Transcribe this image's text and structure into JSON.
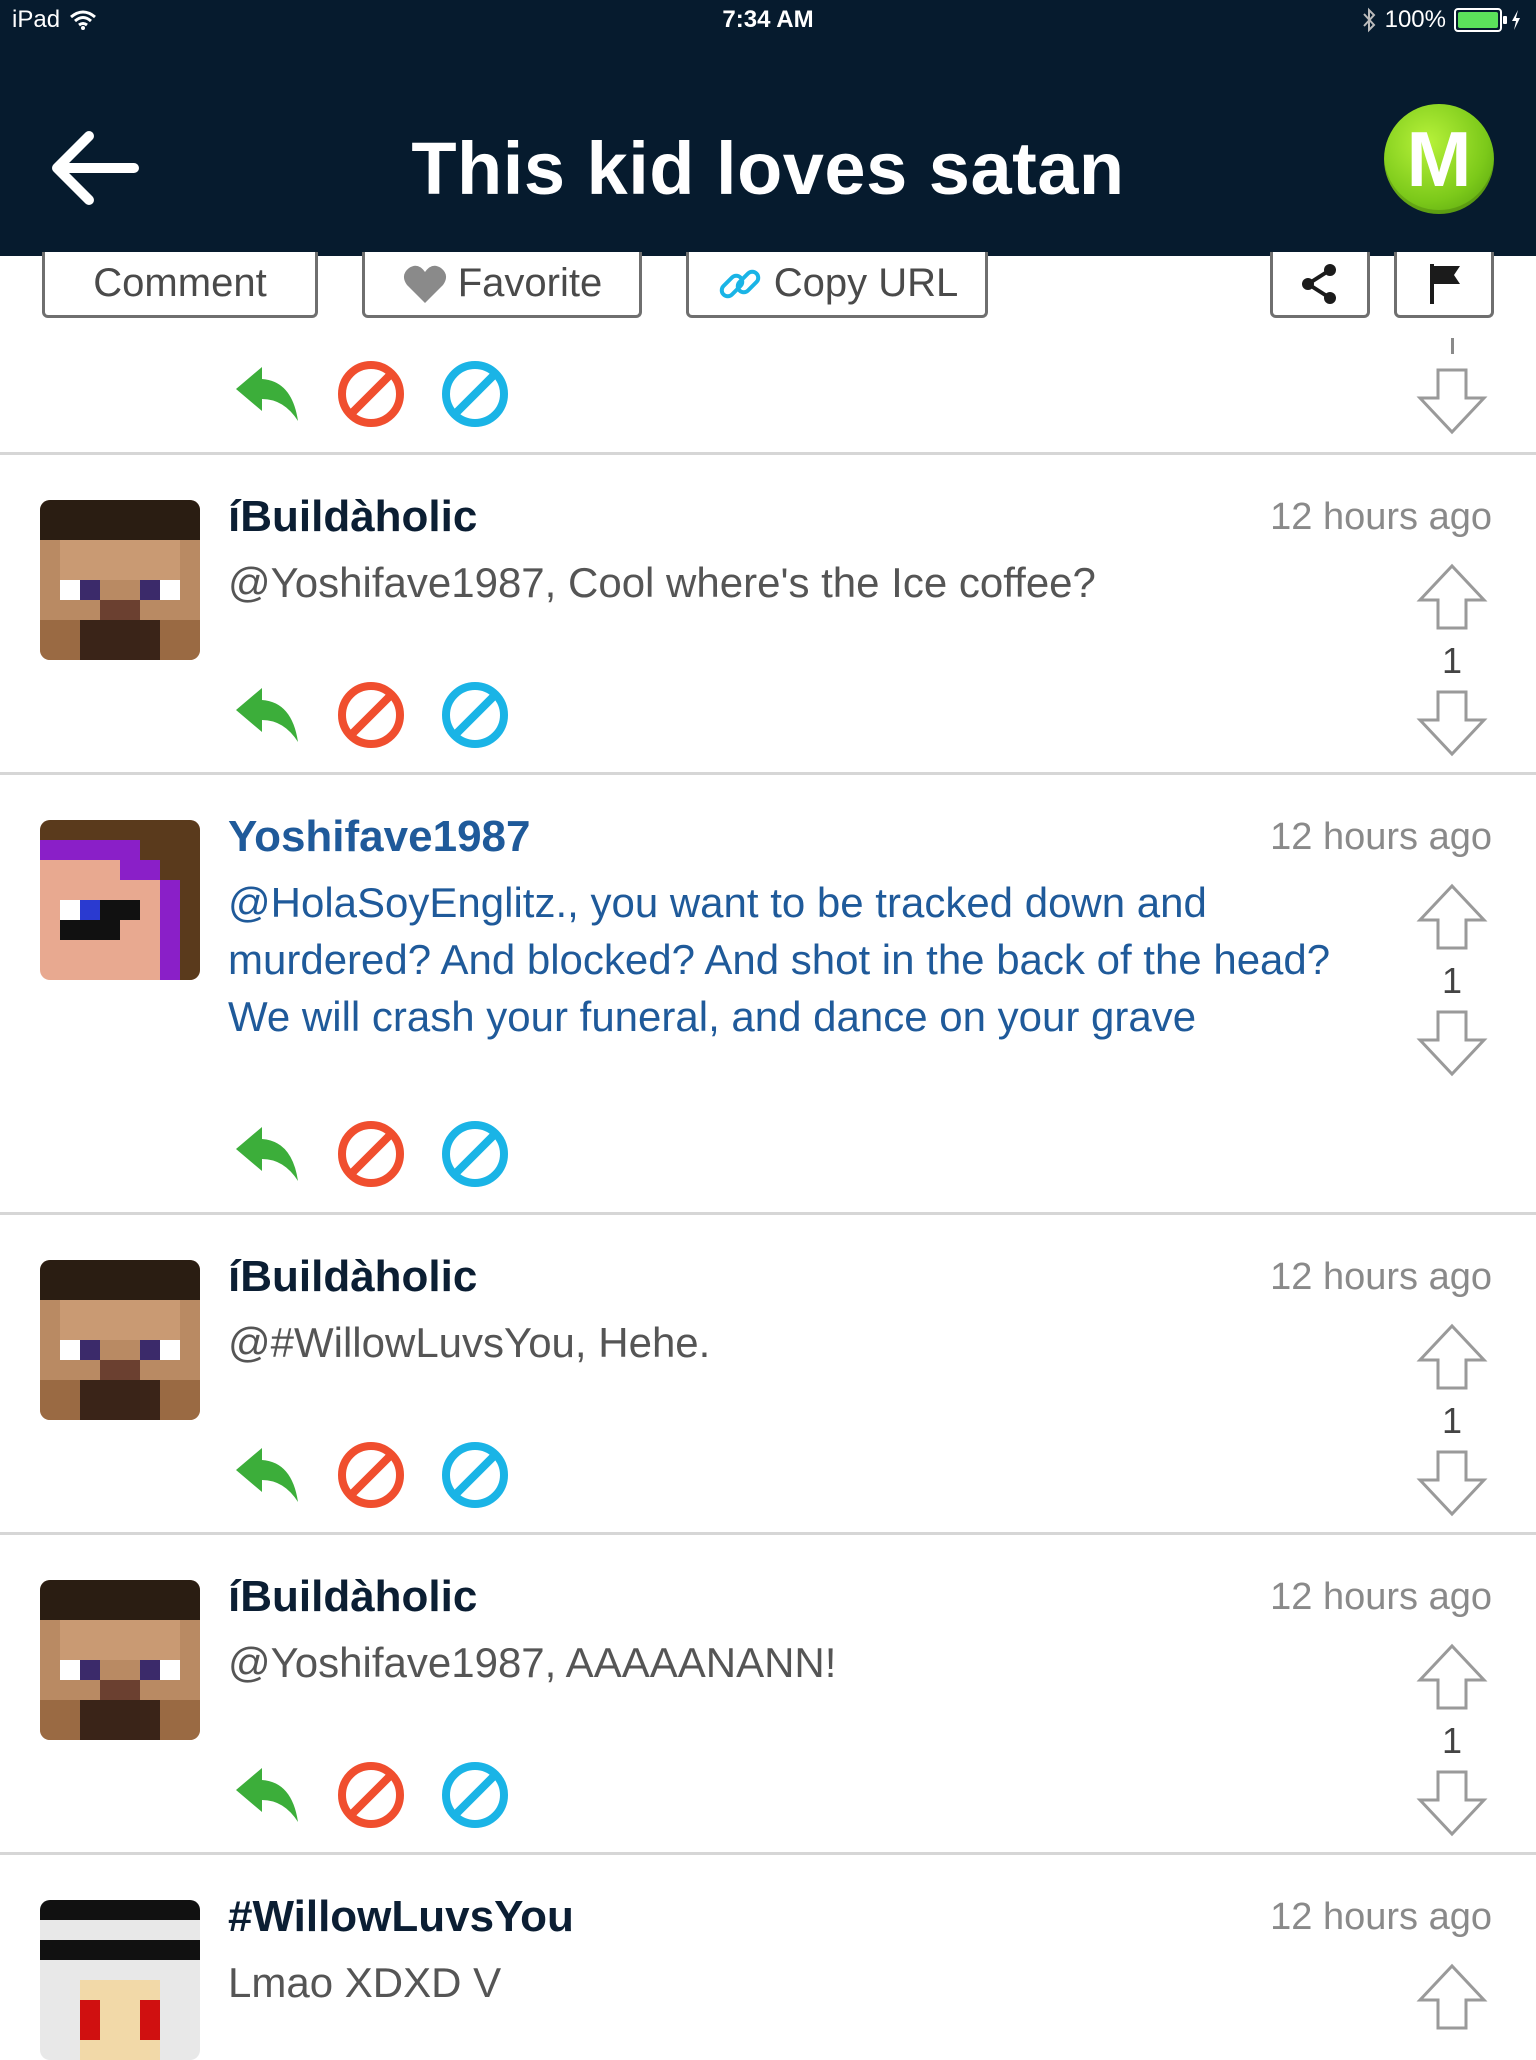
{
  "status_bar": {
    "device": "iPad",
    "time": "7:34 AM",
    "battery": "100%",
    "battery_level": 1.0
  },
  "header": {
    "title": "This kid loves satan",
    "logo_letter": "M"
  },
  "actions": {
    "comment": "Comment",
    "favorite": "Favorite",
    "copy_url": "Copy URL"
  },
  "comments": [
    {
      "username": "íBuildàholic",
      "time": "12 hours ago",
      "text": "@Yoshifave1987, Cool where's the Ice coffee?",
      "votes": "1"
    },
    {
      "username": "Yoshifave1987",
      "time": "12 hours ago",
      "text": "@HolaSoyEnglitz., you want to be tracked down and murdered? And blocked? And shot in the back of the head? We will crash your funeral, and dance on your grave",
      "votes": "1"
    },
    {
      "username": "íBuildàholic",
      "time": "12 hours ago",
      "text": "@#WillowLuvsYou, Hehe.",
      "votes": "1"
    },
    {
      "username": "íBuildàholic",
      "time": "12 hours ago",
      "text": "@Yoshifave1987, AAAAANANN!",
      "votes": "1"
    },
    {
      "username": "#WillowLuvsYou",
      "time": "12 hours ago",
      "text": "Lmao XDXD V"
    }
  ],
  "colors": {
    "header_bg": "#061b2e",
    "reply": "#3cae3a",
    "block": "#f04e2e",
    "report": "#1ab4e6",
    "highlight_text": "#1f5a9a"
  }
}
